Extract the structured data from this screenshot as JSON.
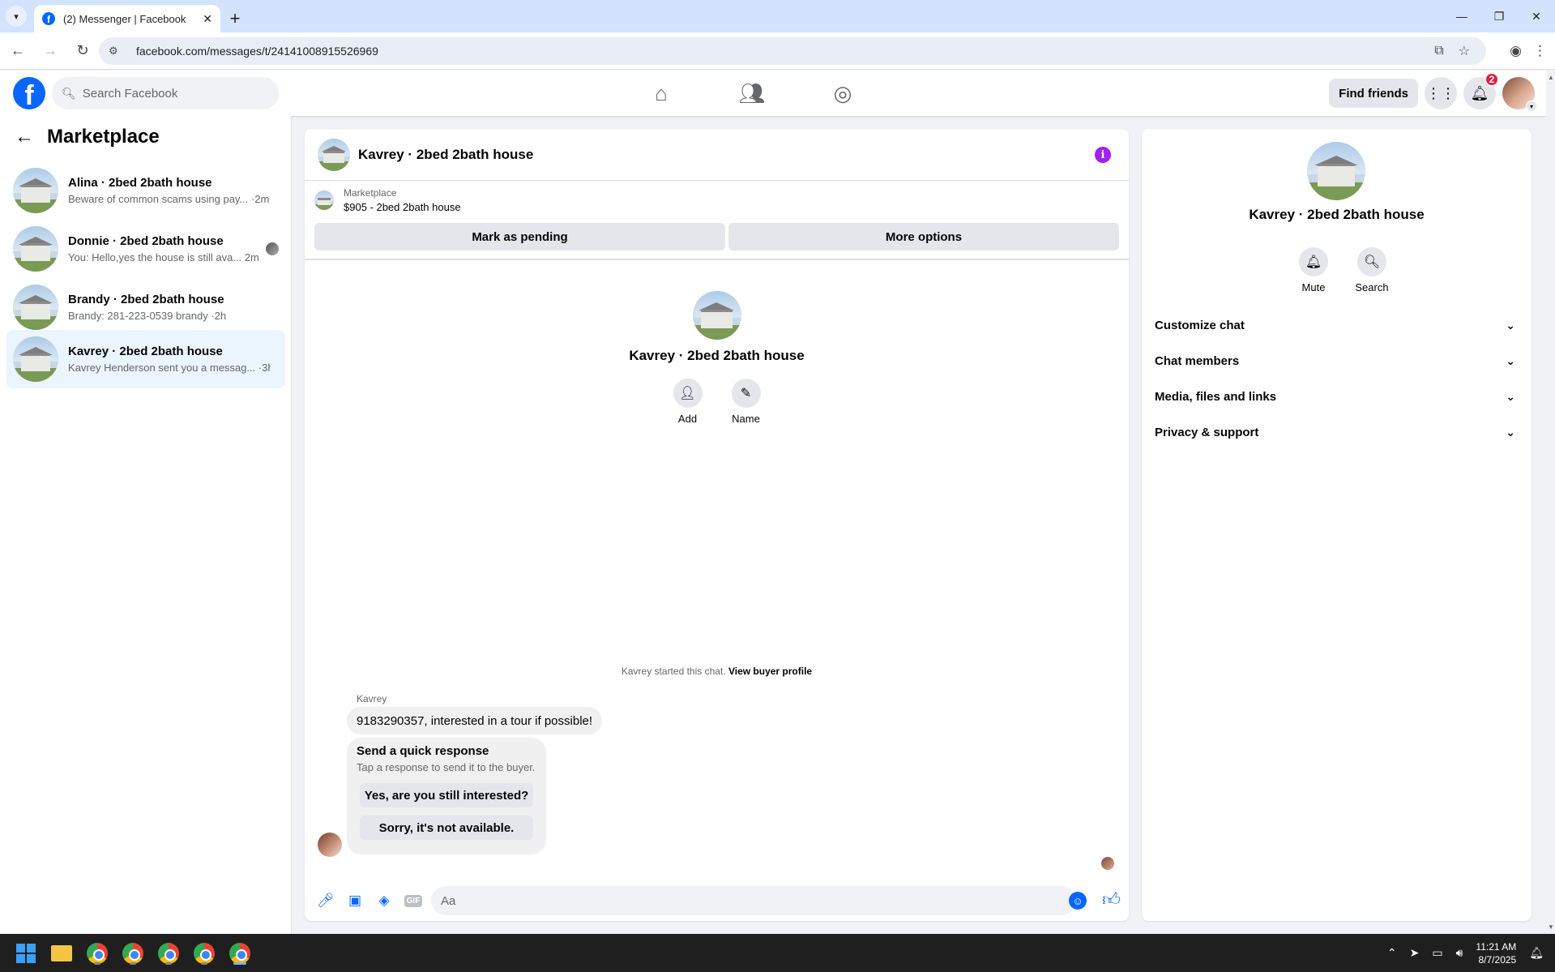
{
  "browser": {
    "tab_title": "(2) Messenger | Facebook",
    "url": "facebook.com/messages/t/24141008915526969"
  },
  "fb": {
    "search_placeholder": "Search Facebook",
    "find_friends": "Find friends",
    "notification_count": "2"
  },
  "sidebar": {
    "title": "Marketplace",
    "conversations": [
      {
        "name": "Alina · 2bed 2bath house",
        "preview": "Beware of common scams using pay... ·2m"
      },
      {
        "name": "Donnie · 2bed 2bath house",
        "preview": "You: Hello,yes the house is still ava...  2m"
      },
      {
        "name": "Brandy · 2bed 2bath house",
        "preview": "Brandy: 281-223-0539 brandy ·2h"
      },
      {
        "name": "Kavrey · 2bed 2bath house",
        "preview": "Kavrey Henderson sent you a messag... ·3h"
      }
    ]
  },
  "chat": {
    "title": "Kavrey · 2bed 2bath house",
    "marketplace_label": "Marketplace",
    "listing": "$905 - 2bed 2bath house",
    "mark_pending": "Mark as pending",
    "more_options": "More options",
    "intro_name": "Kavrey · 2bed 2bath house",
    "add_label": "Add",
    "name_label": "Name",
    "start_note": "Kavrey started this chat.",
    "view_buyer_profile": "View buyer profile",
    "sender": "Kavrey",
    "message": "9183290357, interested in a tour if possible!",
    "quick_title": "Send a quick response",
    "quick_sub": "Tap a response to send it to the buyer.",
    "quick_opt1": "Yes, are you still interested?",
    "quick_opt2": "Sorry, it's not available.",
    "input_placeholder": "Aa",
    "gif_label": "GIF"
  },
  "rpanel": {
    "name": "Kavrey · 2bed 2bath house",
    "mute": "Mute",
    "search": "Search",
    "rows": [
      "Customize chat",
      "Chat members",
      "Media, files and links",
      "Privacy & support"
    ]
  },
  "taskbar": {
    "time": "11:21 AM",
    "date": "8/7/2025"
  }
}
